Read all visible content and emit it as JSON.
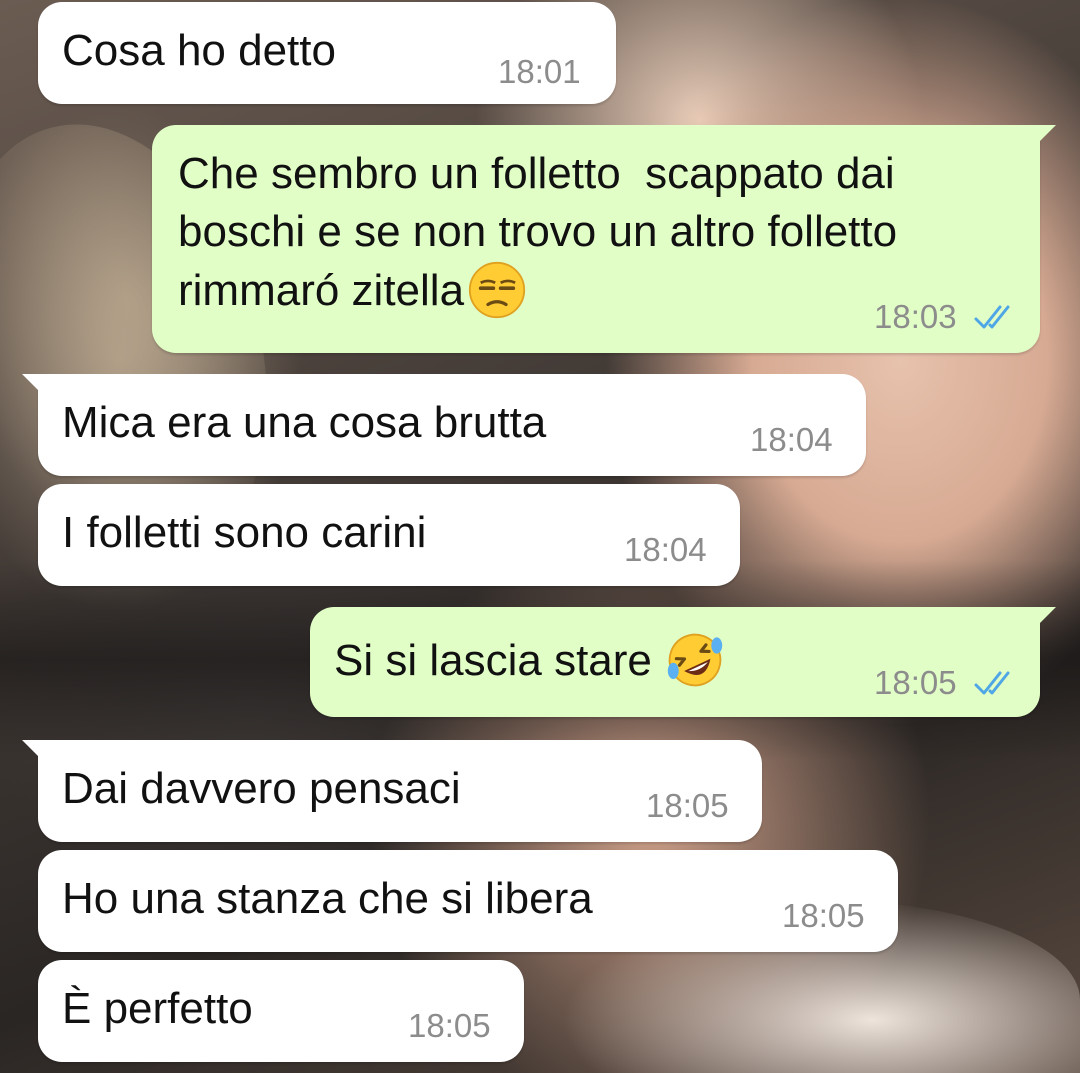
{
  "theme": {
    "incoming_bubble": "#ffffff",
    "outgoing_bubble": "#e1fec6",
    "text_color": "#111111",
    "time_color": "#8c8c8c",
    "read_tick_color": "#4fa6e6"
  },
  "messages": [
    {
      "direction": "in",
      "text": "Cosa ho detto",
      "time": "18:01"
    },
    {
      "direction": "out",
      "text_lines": [
        "Che sembro un folletto  scappato dai",
        "boschi e se non trovo un altro folletto",
        "rimmaró zitella"
      ],
      "emoji": "unamused-face-emoji",
      "time": "18:03",
      "status": "read-double-tick-icon"
    },
    {
      "direction": "in",
      "text": "Mica era una cosa brutta",
      "time": "18:04"
    },
    {
      "direction": "in",
      "text": "I folletti sono carini",
      "time": "18:04"
    },
    {
      "direction": "out",
      "text": "Si si lascia stare",
      "emoji": "rolling-on-floor-laughing-emoji",
      "time": "18:05",
      "status": "read-double-tick-icon"
    },
    {
      "direction": "in",
      "text": "Dai davvero pensaci",
      "time": "18:05"
    },
    {
      "direction": "in",
      "text": "Ho una stanza che si libera",
      "time": "18:05"
    },
    {
      "direction": "in",
      "text": "È perfetto",
      "time": "18:05"
    }
  ]
}
